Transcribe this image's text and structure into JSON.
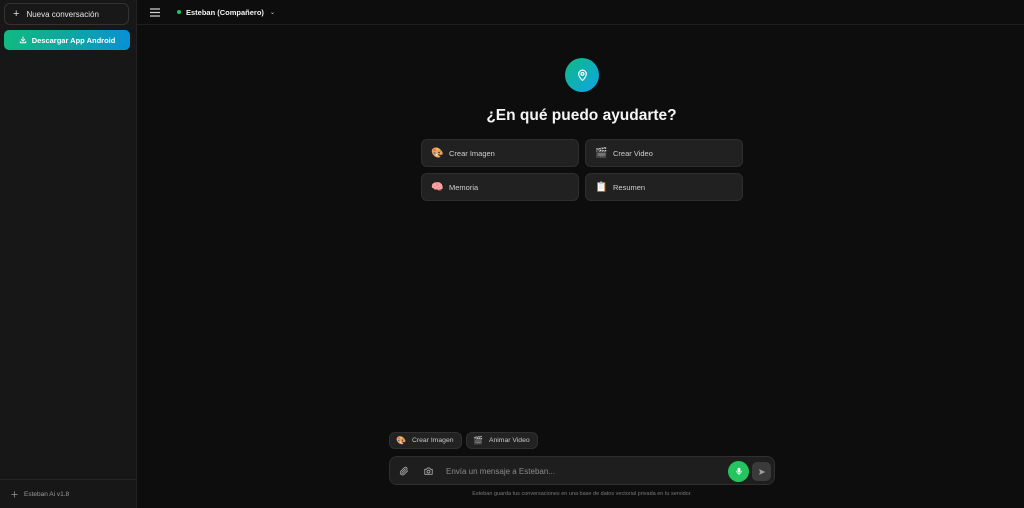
{
  "sidebar": {
    "new_chat_label": "Nueva conversación",
    "download_label": "Descargar App Android",
    "footer_label": "Esteban Ai v1.8"
  },
  "header": {
    "model_name": "Esteban (Compañero)",
    "status_color": "#22c55e"
  },
  "main": {
    "heading": "¿En qué puedo ayudarte?",
    "suggestions": [
      {
        "icon": "palette",
        "emoji": "🎨",
        "label": "Crear Imagen"
      },
      {
        "icon": "clapper-board",
        "emoji": "🎬",
        "label": "Crear Video"
      },
      {
        "icon": "brain",
        "emoji": "🧠",
        "label": "Memoria"
      },
      {
        "icon": "clipboard",
        "emoji": "📋",
        "label": "Resumen"
      }
    ]
  },
  "composer": {
    "chips": [
      {
        "icon": "palette",
        "emoji": "🎨",
        "label": "Crear Imagen"
      },
      {
        "icon": "clapper-board",
        "emoji": "🎬",
        "label": "Animar Video"
      }
    ],
    "placeholder": "Envía un mensaje a Esteban...",
    "disclaimer": "Esteban guarda tus conversaciones en una base de datos vectorial privada en tu servidor.",
    "mic_color": "#22c55e"
  },
  "colors": {
    "accent_green": "#10b981",
    "accent_blue": "#0ea5e9",
    "background": "#0d0d0d",
    "sidebar": "#171717"
  }
}
